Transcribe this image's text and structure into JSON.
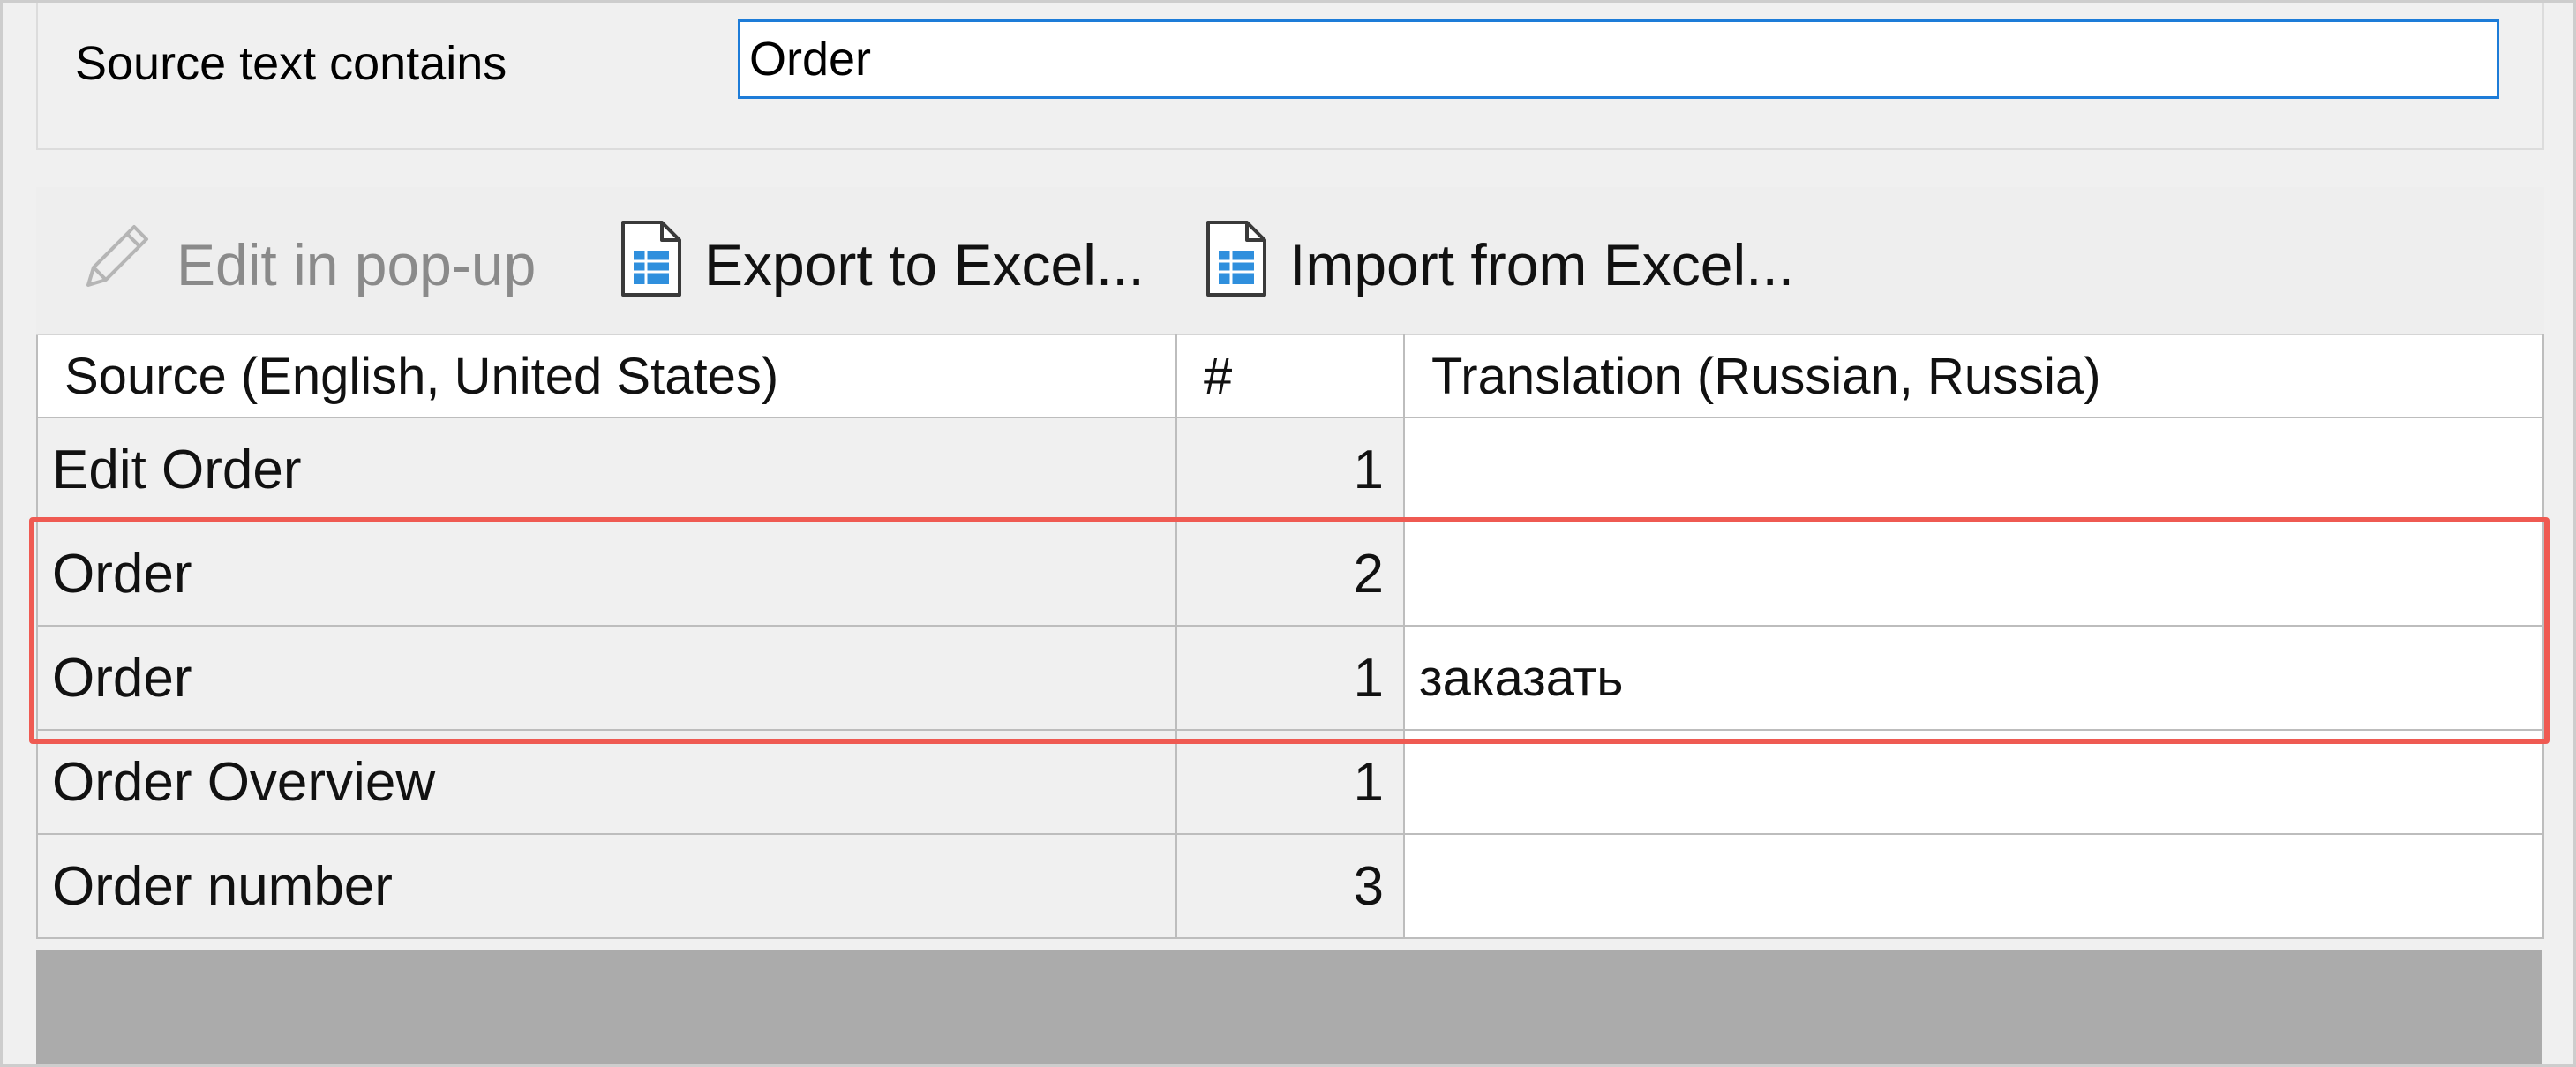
{
  "filter": {
    "label": "Source text contains",
    "value": "Order"
  },
  "toolbar": {
    "edit_popup_label": "Edit in pop-up",
    "export_label": "Export to Excel...",
    "import_label": "Import from Excel..."
  },
  "grid": {
    "columns": {
      "source": "Source (English, United States)",
      "count": "#",
      "translation": "Translation (Russian, Russia)"
    },
    "rows": [
      {
        "source": "Edit Order",
        "count": "1",
        "translation": ""
      },
      {
        "source": "Order",
        "count": "2",
        "translation": ""
      },
      {
        "source": "Order",
        "count": "1",
        "translation": "заказать"
      },
      {
        "source": "Order Overview",
        "count": "1",
        "translation": ""
      },
      {
        "source": "Order number",
        "count": "3",
        "translation": ""
      }
    ]
  },
  "colors": {
    "accent_input_border": "#1d7cd8",
    "highlight": "#ef5a52",
    "icon_blue": "#2f8fdd"
  },
  "icons": {
    "edit": "pencil-icon",
    "export": "spreadsheet-icon",
    "import": "spreadsheet-icon"
  }
}
